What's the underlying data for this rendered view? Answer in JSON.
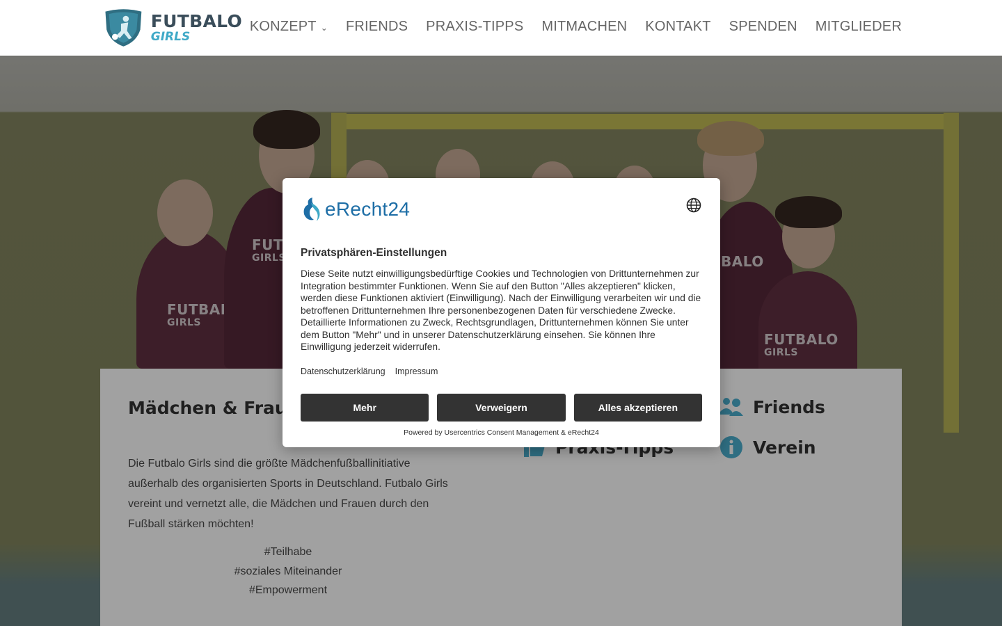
{
  "logo": {
    "line1": "FUTBALO",
    "line2": "GIRLS"
  },
  "nav": {
    "items": [
      {
        "label": "KONZEPT",
        "has_dropdown": true
      },
      {
        "label": "FRIENDS"
      },
      {
        "label": "PRAXIS-TIPPS"
      },
      {
        "label": "MITMACHEN"
      },
      {
        "label": "KONTAKT"
      },
      {
        "label": "SPENDEN"
      },
      {
        "label": "MITGLIEDER"
      }
    ]
  },
  "hero": {
    "jerseys": [
      {
        "line1": "FUTBALO",
        "line2": "GIRLS"
      },
      {
        "line1": "FUT",
        "line2": "GIRLS"
      },
      {
        "line1": "BALO",
        "line2": ""
      },
      {
        "line1": "FUTBALO",
        "line2": "GIRLS"
      }
    ]
  },
  "main": {
    "title": "Mädchen & Frauen stärken!",
    "body": "Die Futbalo Girls sind die größte Mädchenfußballinitiative außerhalb des organisierten Sports in Deutschland. Futbalo Girls vereint und vernetzt alle, die Mädchen und Frauen durch den Fußball stärken möchten!",
    "tags": [
      "#Teilhabe",
      "#soziales Miteinander",
      "#Empowerment"
    ],
    "features": [
      {
        "label": "Friends",
        "icon": "users-icon"
      },
      {
        "label": "Praxis-Tipps",
        "icon": "thumbs-up-icon"
      },
      {
        "label": "Verein",
        "icon": "info-icon"
      }
    ]
  },
  "consent": {
    "brand": "eRecht24",
    "title": "Privatsphären-Einstellungen",
    "text": "Diese Seite nutzt einwilligungsbedürftige Cookies und Technologien von Drittunternehmen zur Integration bestimmter Funktionen. Wenn Sie auf den Button \"Alles akzeptieren\" klicken, werden diese Funktionen aktiviert (Einwilligung). Nach der Einwilligung verarbeiten wir und die betroffenen Drittunternehmen Ihre personenbezogenen Daten für verschiedene Zwecke. Detaillierte Informationen zu Zweck, Rechtsgrundlagen, Drittunternehmen können Sie unter dem Button \"Mehr\" und in unserer Datenschutzerklärung einsehen. Sie können Ihre Einwilligung jederzeit widerrufen.",
    "links": [
      "Datenschutzerklärung",
      "Impressum"
    ],
    "buttons": {
      "more": "Mehr",
      "deny": "Verweigern",
      "accept": "Alles akzeptieren"
    },
    "powered": "Powered by Usercentrics Consent Management & eRecht24"
  },
  "colors": {
    "accent": "#3fa9c7",
    "dark_button": "#333333",
    "logo_dark": "#3a4d5a"
  }
}
